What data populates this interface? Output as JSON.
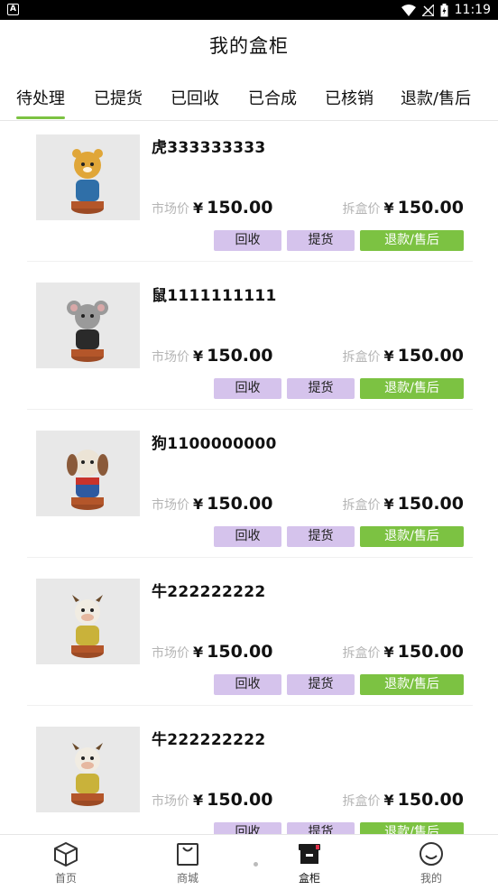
{
  "status": {
    "time": "11:19",
    "left_icon": "A"
  },
  "header": {
    "title": "我的盒柜"
  },
  "tabs": [
    {
      "label": "待处理",
      "active": true
    },
    {
      "label": "已提货",
      "active": false
    },
    {
      "label": "已回收",
      "active": false
    },
    {
      "label": "已合成",
      "active": false
    },
    {
      "label": "已核销",
      "active": false
    },
    {
      "label": "退款/售后",
      "active": false
    }
  ],
  "labels": {
    "market_price": "市场价",
    "unbox_price": "拆盒价",
    "currency": "¥"
  },
  "items": [
    {
      "name": "虎333333333",
      "market_price": "150.00",
      "unbox_price": "150.00",
      "figure": "tiger",
      "btn_recycle": "回收",
      "btn_pickup": "提货",
      "btn_refund": "退款/售后"
    },
    {
      "name": "鼠1111111111",
      "market_price": "150.00",
      "unbox_price": "150.00",
      "figure": "mouse",
      "btn_recycle": "回收",
      "btn_pickup": "提货",
      "btn_refund": "退款/售后"
    },
    {
      "name": "狗1100000000",
      "market_price": "150.00",
      "unbox_price": "150.00",
      "figure": "dog",
      "btn_recycle": "回收",
      "btn_pickup": "提货",
      "btn_refund": "退款/售后"
    },
    {
      "name": "牛222222222",
      "market_price": "150.00",
      "unbox_price": "150.00",
      "figure": "ox",
      "btn_recycle": "回收",
      "btn_pickup": "提货",
      "btn_refund": "退款/售后"
    },
    {
      "name": "牛222222222",
      "market_price": "150.00",
      "unbox_price": "150.00",
      "figure": "ox",
      "btn_recycle": "回收",
      "btn_pickup": "提货",
      "btn_refund": "退款/售后"
    }
  ],
  "bottom_nav": [
    {
      "label": "首页",
      "icon": "cube-icon",
      "active": false
    },
    {
      "label": "商城",
      "icon": "bag-icon",
      "active": false
    },
    {
      "label": "盒柜",
      "icon": "box-icon",
      "active": true
    },
    {
      "label": "我的",
      "icon": "smile-icon",
      "active": false
    }
  ],
  "colors": {
    "accent_green": "#7cc242",
    "button_purple": "#d5c3ec",
    "muted_label": "#b5b5b5"
  }
}
